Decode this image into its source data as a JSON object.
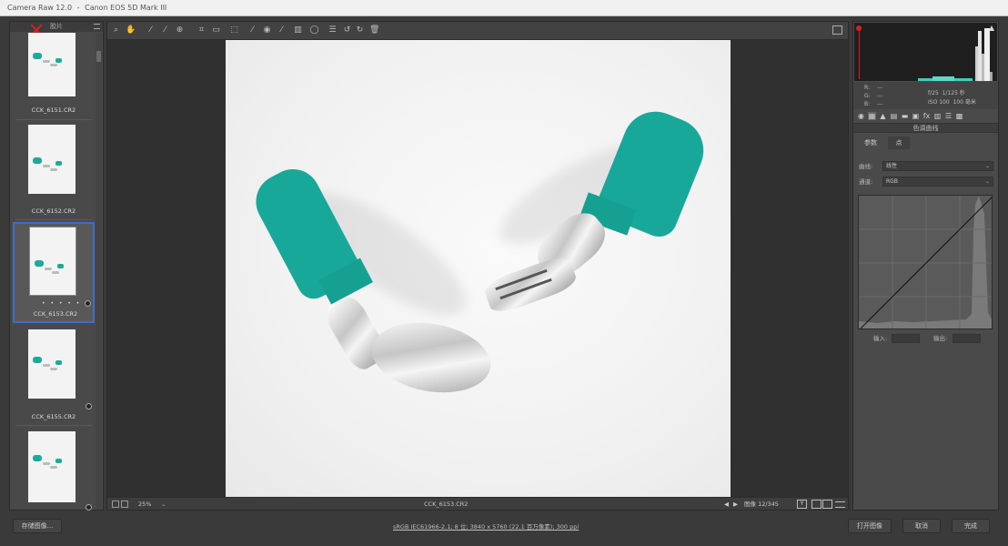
{
  "window": {
    "app_title": "Camera Raw 12.0",
    "separator": "-",
    "camera_model": "Canon EOS 5D Mark III"
  },
  "filmstrip": {
    "header": "胶片",
    "items": [
      {
        "filename": "CCK_6151.CR2",
        "rejected": true,
        "selected": false
      },
      {
        "filename": "CCK_6152.CR2",
        "rejected": true,
        "selected": false
      },
      {
        "filename": "CCK_6153.CR2",
        "rejected": false,
        "selected": true,
        "stars": "• • • • •"
      },
      {
        "filename": "CCK_6155.CR2",
        "rejected": true,
        "selected": false
      },
      {
        "filename": "",
        "rejected": false,
        "selected": false
      }
    ]
  },
  "status": {
    "zoom": "25%",
    "zoom_caret": "⌄",
    "current_file": "CCK_6153.CR2",
    "image_label": "图像",
    "image_count": "12/345",
    "prev_arrow": "◀",
    "next_arrow": "▶",
    "view_y": "Y"
  },
  "histogram": {
    "r_label": "R:",
    "g_label": "G:",
    "b_label": "B:",
    "r_value": "---",
    "g_value": "---",
    "b_value": "---",
    "aperture": "f/25",
    "shutter": "1/125 秒",
    "iso": "ISO 100",
    "focal_length": "100 毫米"
  },
  "panel": {
    "title": "色调曲线",
    "tabs": [
      {
        "label": "参数"
      },
      {
        "label": "点"
      }
    ],
    "active_tab": 1,
    "curve_label": "曲线:",
    "curve_value": "线性",
    "channel_label": "通道:",
    "channel_value": "RGB",
    "input_label": "输入:",
    "output_label": "输出:"
  },
  "bottom": {
    "save_label": "存储图像...",
    "workflow_text": "sRGB IEC61966-2.1; 8 位; 3840 x 5760 (22.1 百万像素); 300 ppi",
    "open_label": "打开图像",
    "cancel_label": "取消",
    "done_label": "完成"
  },
  "colors": {
    "selection": "#3b6fc8",
    "reject": "#d92020",
    "silicone": "#18a89a"
  }
}
